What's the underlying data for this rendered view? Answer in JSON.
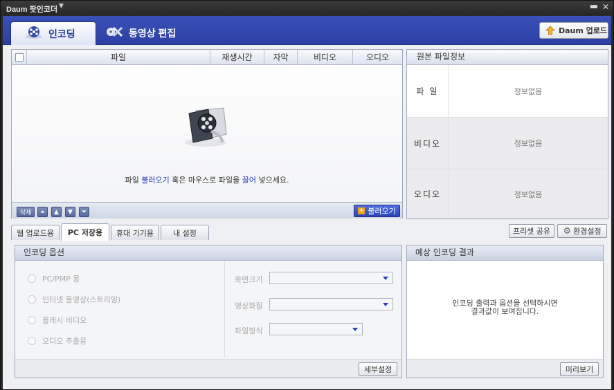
{
  "window": {
    "title": "Daum 팟인코더"
  },
  "main_tabs": [
    {
      "label": "인코딩"
    },
    {
      "label": "동영상 편집"
    }
  ],
  "upload_button": "Daum 업로드",
  "file_table": {
    "columns": [
      "파일",
      "재생시간",
      "자막",
      "비디오",
      "오디오"
    ],
    "drop_text": {
      "before": "파일 ",
      "link1": "불러오기",
      "middle": " 혹은 마우스로 파일을 ",
      "link2": "끌어",
      "after": " 넣으세요."
    }
  },
  "file_toolbar": {
    "delete": "삭제",
    "load": "불러오기"
  },
  "source_info": {
    "title": "원본 파일정보",
    "rows": [
      {
        "label": "파 일",
        "value": "정보없음"
      },
      {
        "label": "비디오",
        "value": "정보없음"
      },
      {
        "label": "오디오",
        "value": "정보없음"
      }
    ]
  },
  "sub_tabs": [
    {
      "label": "웹 업로드용"
    },
    {
      "label": "PC 저장용"
    },
    {
      "label": "휴대 기기용"
    },
    {
      "label": "내 설정"
    }
  ],
  "preset_share": "프리셋 공유",
  "settings": "환경설정",
  "options": {
    "title": "인코딩 옵션",
    "radios": [
      "PC/PMP 용",
      "인터넷 동영상(스트리밍)",
      "플래시 비디오",
      "오디오 추출용"
    ],
    "fields": [
      {
        "label": "화면크기",
        "value": ""
      },
      {
        "label": "영상화질",
        "value": ""
      },
      {
        "label": "파일형식",
        "value": ""
      }
    ],
    "detail_button": "세부설정"
  },
  "result": {
    "title": "예상 인코딩 결과",
    "line1": "인코딩 출력과 옵션을 선택하시면",
    "line2": "결과값이 보여집니다.",
    "preview_button": "미리보기"
  },
  "colors": {
    "accent": "#2d3fa4",
    "link": "#2a3fb8"
  }
}
